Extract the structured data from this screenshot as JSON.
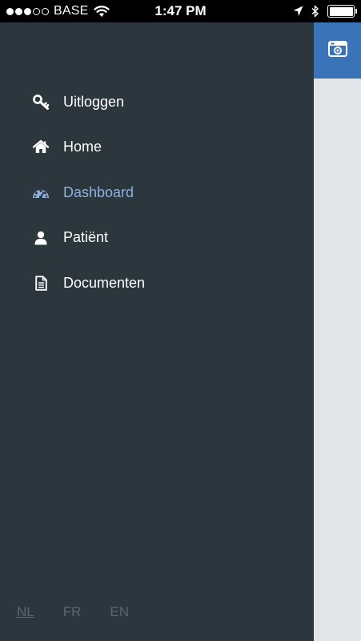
{
  "status_bar": {
    "carrier": "BASE",
    "time": "1:47 PM",
    "signal": [
      true,
      true,
      true,
      false,
      false
    ],
    "icons": [
      "wifi-icon",
      "location-arrow-icon",
      "bluetooth-icon",
      "battery-icon"
    ],
    "battery_level": 1.0
  },
  "menu": {
    "items": [
      {
        "label": "Uitloggen",
        "icon": "key-icon",
        "active": false
      },
      {
        "label": "Home",
        "icon": "home-icon",
        "active": false
      },
      {
        "label": "Dashboard",
        "icon": "dashboard-icon",
        "active": true
      },
      {
        "label": "Patiënt",
        "icon": "user-icon",
        "active": false
      },
      {
        "label": "Documenten",
        "icon": "document-icon",
        "active": false
      }
    ]
  },
  "languages": [
    {
      "code": "NL",
      "selected": true
    },
    {
      "code": "FR",
      "selected": false
    },
    {
      "code": "EN",
      "selected": false
    }
  ],
  "content": {
    "header_icon": "camera-icon"
  },
  "colors": {
    "menu_background": "#2c373d",
    "menu_text": "#ffffff",
    "active_item": "#8fb1df",
    "language_inactive": "#5b666c",
    "header_accent": "#3b73b9",
    "content_background": "#e2e6e9"
  }
}
